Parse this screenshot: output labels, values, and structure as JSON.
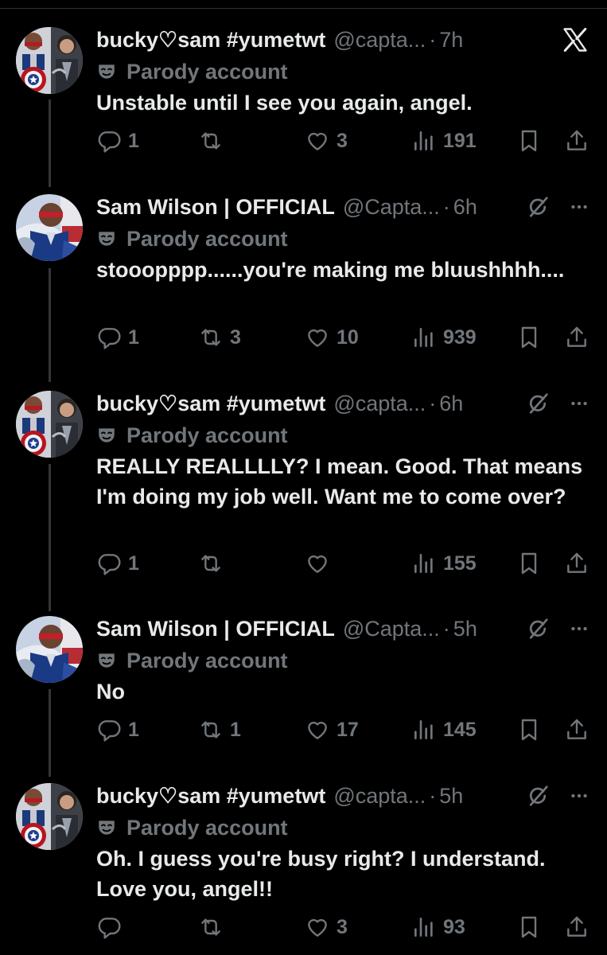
{
  "tweets": [
    {
      "name": "bucky♡sam #yumetwt",
      "handle": "@capta...",
      "sep": "·",
      "time": "7h",
      "avatar": "bucky",
      "badge": "Parody account",
      "text": "Unstable until I see you again, angel.",
      "replies": "1",
      "reposts": "",
      "likes": "3",
      "views": "191",
      "header_icon": "x-logo-icon"
    },
    {
      "name": "Sam Wilson | OFFICIAL",
      "handle": "@Capta...",
      "sep": "·",
      "time": "6h",
      "avatar": "sam",
      "badge": "Parody account",
      "text": "stooopppp......you're making me bluushhhh....",
      "replies": "1",
      "reposts": "3",
      "likes": "10",
      "views": "939",
      "header_icon": "grok-icon"
    },
    {
      "name": "bucky♡sam #yumetwt",
      "handle": "@capta...",
      "sep": "·",
      "time": "6h",
      "avatar": "bucky",
      "badge": "Parody account",
      "text": "REALLY REALLLLY? I mean. Good. That means I'm doing my job well. Want me to come over?",
      "replies": "1",
      "reposts": "",
      "likes": "",
      "views": "155",
      "header_icon": "grok-icon"
    },
    {
      "name": "Sam Wilson | OFFICIAL",
      "handle": "@Capta...",
      "sep": "·",
      "time": "5h",
      "avatar": "sam",
      "badge": "Parody account",
      "text": "No",
      "replies": "1",
      "reposts": "1",
      "likes": "17",
      "views": "145",
      "header_icon": "grok-icon"
    },
    {
      "name": "bucky♡sam #yumetwt",
      "handle": "@capta...",
      "sep": "·",
      "time": "5h",
      "avatar": "bucky",
      "badge": "Parody account",
      "text": "Oh. I guess you're busy right? I understand. Love you, angel!!",
      "replies": "",
      "reposts": "",
      "likes": "3",
      "views": "93",
      "header_icon": "grok-icon"
    }
  ],
  "colors": {
    "background": "#000000",
    "text": "#e7e9ea",
    "muted": "#71767b",
    "thread_line": "#333639"
  }
}
